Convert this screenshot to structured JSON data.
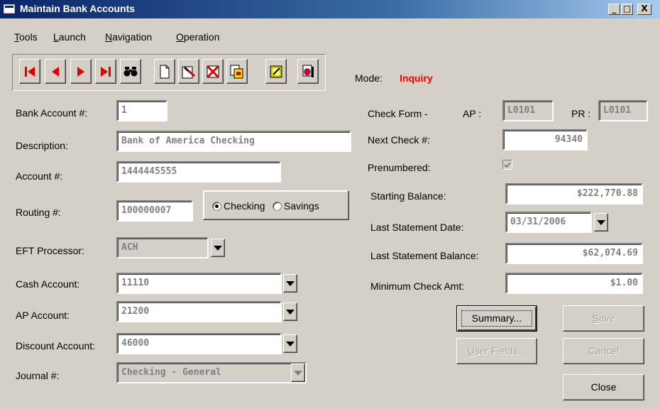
{
  "window": {
    "title": "Maintain Bank Accounts",
    "minimize": "_",
    "maximize": "□",
    "close": "X"
  },
  "menu": [
    {
      "mn": "T",
      "rest": "ools"
    },
    {
      "mn": "L",
      "rest": "aunch"
    },
    {
      "mn": "N",
      "rest": "avigation"
    },
    {
      "mn": "O",
      "rest": "peration"
    }
  ],
  "toolbar": {
    "icons": [
      "first-record-icon",
      "previous-record-icon",
      "next-record-icon",
      "last-record-icon",
      "find-icon",
      "new-record-icon",
      "edit-record-icon",
      "delete-record-icon",
      "copy-record-icon",
      "notes-icon",
      "print-icon"
    ]
  },
  "mode": {
    "label": "Mode:",
    "value": "Inquiry",
    "color": "#ff0000"
  },
  "fields": {
    "bank_account": {
      "label": "Bank Account #:",
      "value": "1"
    },
    "description": {
      "label": "Description:",
      "value": "Bank of America Checking"
    },
    "account_no": {
      "label": "Account #:",
      "value": "1444445555"
    },
    "routing": {
      "label": "Routing #:",
      "value": "100000007"
    },
    "account_type": {
      "checking": "Checking",
      "savings": "Savings",
      "selected": "Checking"
    },
    "eft": {
      "label": "EFT Processor:",
      "value": "ACH"
    },
    "cash_account": {
      "label": "Cash Account:",
      "value": "11110"
    },
    "ap_account": {
      "label": "AP Account:",
      "value": "21200"
    },
    "discount_account": {
      "label": "Discount Account:",
      "value": "46000"
    },
    "journal": {
      "label": "Journal #:",
      "value": "Checking - General"
    },
    "check_form": {
      "label": "Check Form -",
      "ap_label": "AP :",
      "ap_value": "L0101",
      "pr_label": "PR :",
      "pr_value": "L0101"
    },
    "next_check": {
      "label": "Next Check #:",
      "value": "94340"
    },
    "prenumbered": {
      "label": "Prenumbered:",
      "checked": true
    },
    "starting_balance": {
      "label": "Starting Balance:",
      "value": "$222,770.88"
    },
    "last_statement_date": {
      "label": "Last Statement Date:",
      "value": "03/31/2006"
    },
    "last_statement_balance": {
      "label": "Last Statement Balance:",
      "value": "$62,074.69"
    },
    "min_check_amt": {
      "label": "Minimum Check Amt:",
      "value": "$1.00"
    }
  },
  "buttons": {
    "summary": {
      "mn": "",
      "label": "Summary..."
    },
    "user_fields": {
      "mn": "U",
      "rest": "ser Fields..."
    },
    "save": {
      "mn": "S",
      "rest": "ave"
    },
    "cancel": {
      "label": "Cancel"
    },
    "close": {
      "label": "Close"
    }
  }
}
